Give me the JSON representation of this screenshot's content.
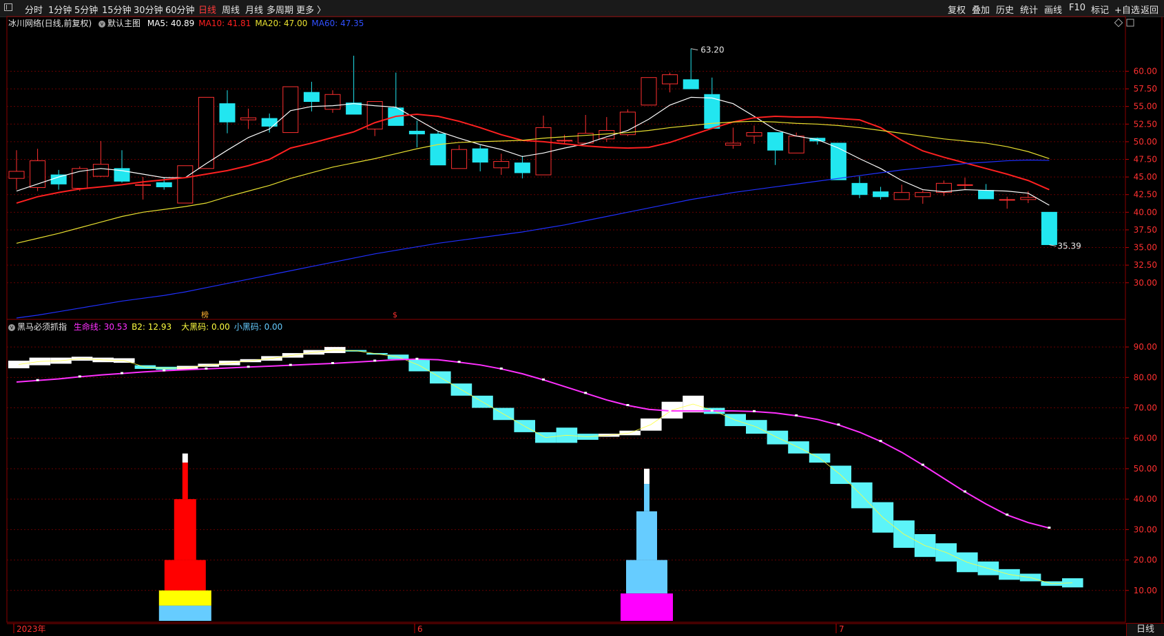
{
  "toolbar": {
    "periods": [
      "分时",
      "1分钟",
      "5分钟",
      "15分钟",
      "30分钟",
      "60分钟",
      "日线",
      "周线",
      "月线",
      "多周期",
      "更多 〉"
    ],
    "active_period": "日线",
    "right_items": [
      "复权",
      "叠加",
      "历史",
      "统计",
      "画线",
      "F10",
      "标记",
      "+自选",
      "返回"
    ]
  },
  "main_panel": {
    "stock_title": "冰川网络(日线,前复权)",
    "template_label": "默认主图",
    "ma": [
      {
        "label": "MA5: 40.89",
        "color": "#ffffff"
      },
      {
        "label": "MA10: 41.81",
        "color": "#ff2020"
      },
      {
        "label": "MA20: 47.00",
        "color": "#e8e030"
      },
      {
        "label": "MA60: 47.35",
        "color": "#3050ff"
      }
    ],
    "high_label": "63.20",
    "low_label": "35.39",
    "marker_a": "榜",
    "marker_b": "$"
  },
  "indicator_panel": {
    "name": "黑马必须抓指",
    "lines": [
      {
        "label": "生命线: 30.53",
        "color": "#ff30ff"
      },
      {
        "label": "B2: 12.93",
        "color": "#ffff40"
      },
      {
        "label": "大黑码: 0.00",
        "color": "#ffff40"
      },
      {
        "label": "小黑码: 0.00",
        "color": "#66ccff"
      }
    ]
  },
  "date_labels": [
    "2023年",
    "6",
    "7"
  ],
  "bottom_tab": "日线",
  "chart_data": [
    {
      "type": "candlestick",
      "y_ticks": [
        30.0,
        32.5,
        35.0,
        37.5,
        40.0,
        42.5,
        45.0,
        47.5,
        50.0,
        52.5,
        55.0,
        57.5,
        60.0
      ],
      "ylim": [
        25.0,
        66.0
      ],
      "candles": [
        {
          "o": 44.8,
          "h": 48.8,
          "l": 43.2,
          "c": 45.8
        },
        {
          "o": 43.5,
          "h": 49.0,
          "l": 43.0,
          "c": 47.3
        },
        {
          "o": 45.3,
          "h": 46.0,
          "l": 43.2,
          "c": 44.0
        },
        {
          "o": 43.4,
          "h": 46.5,
          "l": 43.0,
          "c": 46.2
        },
        {
          "o": 45.1,
          "h": 50.1,
          "l": 45.0,
          "c": 46.8
        },
        {
          "o": 46.2,
          "h": 48.8,
          "l": 44.2,
          "c": 44.4
        },
        {
          "o": 43.9,
          "h": 45.0,
          "l": 41.8,
          "c": 43.9
        },
        {
          "o": 44.2,
          "h": 45.0,
          "l": 43.2,
          "c": 43.6
        },
        {
          "o": 41.3,
          "h": 46.6,
          "l": 41.3,
          "c": 46.6
        },
        {
          "o": 46.2,
          "h": 56.3,
          "l": 46.2,
          "c": 56.3
        },
        {
          "o": 55.4,
          "h": 57.3,
          "l": 51.2,
          "c": 52.8
        },
        {
          "o": 53.1,
          "h": 54.7,
          "l": 51.8,
          "c": 53.4
        },
        {
          "o": 53.3,
          "h": 54.0,
          "l": 51.3,
          "c": 52.2
        },
        {
          "o": 51.3,
          "h": 57.8,
          "l": 51.3,
          "c": 57.8
        },
        {
          "o": 57.0,
          "h": 58.5,
          "l": 54.3,
          "c": 55.7
        },
        {
          "o": 54.6,
          "h": 57.3,
          "l": 54.1,
          "c": 56.7
        },
        {
          "o": 55.5,
          "h": 62.2,
          "l": 53.9,
          "c": 53.9
        },
        {
          "o": 51.8,
          "h": 55.7,
          "l": 50.8,
          "c": 55.7
        },
        {
          "o": 54.8,
          "h": 59.8,
          "l": 52.8,
          "c": 52.3
        },
        {
          "o": 51.5,
          "h": 53.0,
          "l": 49.2,
          "c": 51.1
        },
        {
          "o": 51.1,
          "h": 51.5,
          "l": 46.7,
          "c": 46.7
        },
        {
          "o": 46.2,
          "h": 49.5,
          "l": 46.2,
          "c": 48.9
        },
        {
          "o": 49.0,
          "h": 49.5,
          "l": 45.8,
          "c": 47.1
        },
        {
          "o": 46.3,
          "h": 48.3,
          "l": 45.3,
          "c": 47.2
        },
        {
          "o": 47.0,
          "h": 48.0,
          "l": 44.8,
          "c": 45.6
        },
        {
          "o": 45.3,
          "h": 53.7,
          "l": 45.3,
          "c": 52.0
        },
        {
          "o": 50.2,
          "h": 51.0,
          "l": 49.7,
          "c": 50.2
        },
        {
          "o": 49.8,
          "h": 53.8,
          "l": 49.8,
          "c": 51.2
        },
        {
          "o": 50.4,
          "h": 53.5,
          "l": 50.0,
          "c": 51.6
        },
        {
          "o": 51.0,
          "h": 54.6,
          "l": 50.8,
          "c": 54.2
        },
        {
          "o": 55.2,
          "h": 59.1,
          "l": 55.2,
          "c": 59.1
        },
        {
          "o": 58.2,
          "h": 59.8,
          "l": 57.0,
          "c": 59.5
        },
        {
          "o": 58.8,
          "h": 63.2,
          "l": 57.5,
          "c": 57.5
        },
        {
          "o": 56.7,
          "h": 59.1,
          "l": 51.9,
          "c": 51.9
        },
        {
          "o": 49.5,
          "h": 52.0,
          "l": 49.0,
          "c": 49.8
        },
        {
          "o": 50.8,
          "h": 52.3,
          "l": 49.7,
          "c": 51.3
        },
        {
          "o": 51.3,
          "h": 51.3,
          "l": 46.7,
          "c": 48.8
        },
        {
          "o": 48.4,
          "h": 51.3,
          "l": 48.4,
          "c": 50.8
        },
        {
          "o": 50.5,
          "h": 50.6,
          "l": 49.6,
          "c": 50.1
        },
        {
          "o": 49.8,
          "h": 49.8,
          "l": 44.6,
          "c": 44.6
        },
        {
          "o": 44.1,
          "h": 45.1,
          "l": 42.0,
          "c": 42.5
        },
        {
          "o": 42.9,
          "h": 43.6,
          "l": 41.8,
          "c": 42.2
        },
        {
          "o": 41.8,
          "h": 43.9,
          "l": 41.8,
          "c": 42.8
        },
        {
          "o": 42.2,
          "h": 43.1,
          "l": 41.2,
          "c": 42.8
        },
        {
          "o": 42.8,
          "h": 44.5,
          "l": 42.3,
          "c": 44.1
        },
        {
          "o": 43.9,
          "h": 44.9,
          "l": 43.2,
          "c": 43.9
        },
        {
          "o": 43.1,
          "h": 44.0,
          "l": 41.9,
          "c": 41.9
        },
        {
          "o": 41.8,
          "h": 42.2,
          "l": 40.5,
          "c": 41.8
        },
        {
          "o": 41.8,
          "h": 43.0,
          "l": 41.3,
          "c": 42.1
        },
        {
          "o": 40.0,
          "h": 40.0,
          "l": 35.4,
          "c": 35.4
        }
      ],
      "ma_series": [
        {
          "name": "MA5",
          "color": "#ffffff",
          "values": [
            43.0,
            44.0,
            45.0,
            45.8,
            46.2,
            45.9,
            45.4,
            44.9,
            44.9,
            46.9,
            48.8,
            50.6,
            51.8,
            54.4,
            55.0,
            55.1,
            55.4,
            55.1,
            54.9,
            53.2,
            51.5,
            50.5,
            49.6,
            48.9,
            47.9,
            48.4,
            49.1,
            49.7,
            50.7,
            51.6,
            53.2,
            55.2,
            56.3,
            56.2,
            55.4,
            53.6,
            51.7,
            50.8,
            50.3,
            49.1,
            47.6,
            46.2,
            44.5,
            43.2,
            42.9,
            43.2,
            43.1,
            43.0,
            42.7,
            41.0
          ]
        },
        {
          "name": "MA10",
          "color": "#ff2020",
          "values": [
            41.3,
            42.2,
            42.8,
            43.3,
            43.6,
            43.9,
            44.3,
            44.6,
            44.9,
            45.4,
            45.9,
            46.6,
            47.5,
            49.1,
            49.8,
            50.6,
            51.4,
            52.7,
            53.6,
            53.9,
            53.6,
            52.9,
            52.0,
            51.0,
            50.2,
            50.0,
            49.7,
            49.4,
            49.2,
            49.1,
            49.2,
            49.9,
            50.9,
            51.9,
            52.8,
            53.4,
            53.6,
            53.5,
            53.5,
            53.3,
            53.1,
            52.0,
            50.2,
            48.7,
            47.8,
            47.0,
            46.2,
            45.4,
            44.5,
            43.2
          ]
        },
        {
          "name": "MA20",
          "color": "#e8e030",
          "values": [
            35.6,
            36.3,
            37.0,
            37.8,
            38.6,
            39.4,
            40.0,
            40.4,
            40.8,
            41.3,
            42.2,
            43.0,
            43.8,
            44.8,
            45.6,
            46.4,
            47.0,
            47.6,
            48.3,
            49.0,
            49.6,
            49.9,
            50.0,
            50.1,
            50.2,
            50.5,
            50.7,
            50.9,
            51.1,
            51.3,
            51.6,
            52.0,
            52.3,
            52.6,
            52.8,
            52.9,
            52.8,
            52.6,
            52.5,
            52.3,
            52.0,
            51.6,
            51.2,
            50.8,
            50.4,
            50.1,
            49.8,
            49.3,
            48.6,
            47.6
          ]
        },
        {
          "name": "MA60",
          "color": "#2030ff",
          "values": [
            25.0,
            25.4,
            25.9,
            26.4,
            26.9,
            27.4,
            27.8,
            28.2,
            28.7,
            29.3,
            29.9,
            30.5,
            31.1,
            31.7,
            32.3,
            32.9,
            33.5,
            34.1,
            34.6,
            35.1,
            35.6,
            36.0,
            36.4,
            36.8,
            37.2,
            37.7,
            38.2,
            38.8,
            39.4,
            40.0,
            40.6,
            41.2,
            41.8,
            42.3,
            42.8,
            43.2,
            43.6,
            44.0,
            44.4,
            44.8,
            45.2,
            45.6,
            46.0,
            46.3,
            46.6,
            46.9,
            47.1,
            47.3,
            47.4,
            47.35
          ]
        }
      ]
    },
    {
      "type": "indicator",
      "y_ticks": [
        10.0,
        20.0,
        30.0,
        40.0,
        50.0,
        60.0,
        70.0,
        80.0,
        90.0
      ],
      "ylim": [
        0.0,
        95.0
      ],
      "life_line": [
        78.5,
        79.0,
        79.5,
        80.2,
        80.8,
        81.3,
        81.8,
        82.2,
        82.5,
        82.8,
        83.1,
        83.4,
        83.7,
        84.0,
        84.3,
        84.6,
        85.0,
        85.4,
        85.8,
        86.0,
        85.8,
        85.0,
        84.1,
        82.8,
        81.2,
        79.2,
        77.0,
        74.8,
        72.6,
        70.8,
        69.5,
        69.0,
        69.0,
        69.0,
        69.0,
        68.8,
        68.3,
        67.4,
        66.2,
        64.4,
        62.0,
        59.0,
        55.4,
        51.2,
        46.8,
        42.4,
        38.4,
        34.8,
        32.3,
        30.5
      ],
      "bars": [
        {
          "a": 83.0,
          "b": 85.5
        },
        {
          "a": 84.0,
          "b": 86.5
        },
        {
          "a": 84.5,
          "b": 86.5
        },
        {
          "a": 85.5,
          "b": 86.8
        },
        {
          "a": 85.0,
          "b": 86.5
        },
        {
          "a": 84.8,
          "b": 86.3
        },
        {
          "a": 84.0,
          "b": 82.8
        },
        {
          "a": 83.5,
          "b": 82.5
        },
        {
          "a": 82.5,
          "b": 83.8
        },
        {
          "a": 83.5,
          "b": 84.5
        },
        {
          "a": 84.0,
          "b": 85.5
        },
        {
          "a": 85.0,
          "b": 86.0
        },
        {
          "a": 85.5,
          "b": 87.0
        },
        {
          "a": 86.5,
          "b": 88.0
        },
        {
          "a": 87.5,
          "b": 89.0
        },
        {
          "a": 88.0,
          "b": 90.0
        },
        {
          "a": 89.0,
          "b": 88.5
        },
        {
          "a": 88.0,
          "b": 87.5
        },
        {
          "a": 87.5,
          "b": 86.0
        },
        {
          "a": 86.0,
          "b": 82.0
        },
        {
          "a": 82.0,
          "b": 78.0
        },
        {
          "a": 78.0,
          "b": 74.0
        },
        {
          "a": 74.0,
          "b": 70.0
        },
        {
          "a": 70.0,
          "b": 66.0
        },
        {
          "a": 66.0,
          "b": 62.0
        },
        {
          "a": 62.0,
          "b": 58.5
        },
        {
          "a": 63.5,
          "b": 58.5
        },
        {
          "a": 61.5,
          "b": 59.5
        },
        {
          "a": 60.5,
          "b": 61.5
        },
        {
          "a": 61.0,
          "b": 62.5
        },
        {
          "a": 62.5,
          "b": 66.5
        },
        {
          "a": 66.5,
          "b": 72.0
        },
        {
          "a": 68.5,
          "b": 74.0
        },
        {
          "a": 70.0,
          "b": 68.0
        },
        {
          "a": 68.0,
          "b": 64.0
        },
        {
          "a": 66.0,
          "b": 61.5
        },
        {
          "a": 62.5,
          "b": 58.0
        },
        {
          "a": 59.0,
          "b": 55.0
        },
        {
          "a": 55.0,
          "b": 52.0
        },
        {
          "a": 51.0,
          "b": 45.0
        },
        {
          "a": 45.5,
          "b": 37.0
        },
        {
          "a": 39.0,
          "b": 29.0
        },
        {
          "a": 33.0,
          "b": 24.0
        },
        {
          "a": 28.5,
          "b": 21.0
        },
        {
          "a": 25.5,
          "b": 19.5
        },
        {
          "a": 22.5,
          "b": 16.0
        },
        {
          "a": 19.5,
          "b": 15.0
        },
        {
          "a": 17.0,
          "b": 13.5
        },
        {
          "a": 15.5,
          "b": 13.0
        },
        {
          "a": 13.0,
          "b": 11.5
        },
        {
          "a": 14.0,
          "b": 11.0
        }
      ],
      "signal_red": {
        "index": 8,
        "top": 55.0,
        "red_top": 52.0,
        "steps": [
          40.0,
          20.0,
          10.0
        ],
        "yellow": [
          5.0,
          10.0
        ],
        "blue": [
          0.0,
          5.0
        ]
      },
      "signal_blue": {
        "index": 30,
        "top": 50.0,
        "steps": [
          45.0,
          36.0,
          20.0
        ],
        "magenta": [
          0.0,
          9.0
        ]
      }
    }
  ]
}
